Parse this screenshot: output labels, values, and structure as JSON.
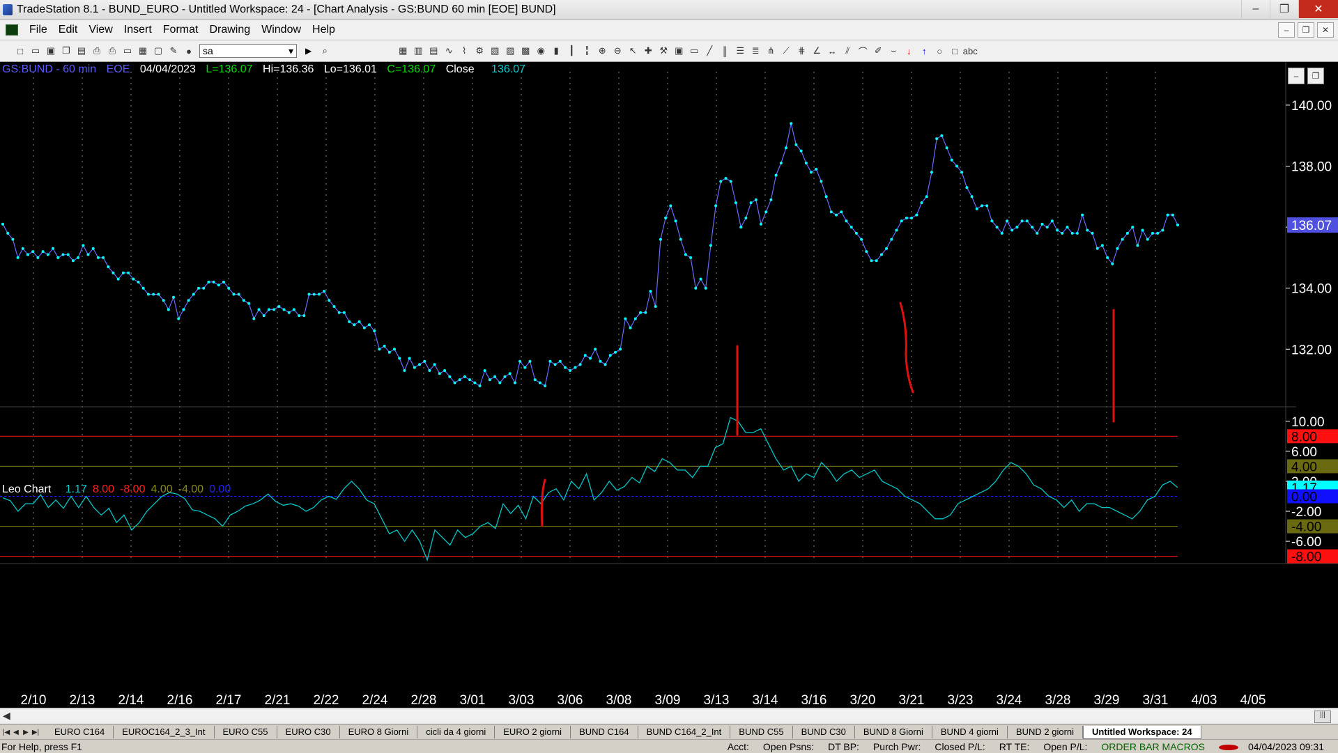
{
  "window": {
    "title": "TradeStation 8.1 - BUND_EURO - Untitled Workspace:  24 - [Chart Analysis - GS:BUND  60 min  [EOE] BUND]",
    "buttons": {
      "minimize": "–",
      "maximize": "❐",
      "close": "✕"
    }
  },
  "menu": {
    "items": [
      "File",
      "Edit",
      "View",
      "Insert",
      "Format",
      "Drawing",
      "Window",
      "Help"
    ],
    "mdi": {
      "minimize": "–",
      "restore": "❐",
      "close": "✕"
    }
  },
  "toolbar": {
    "symbol_value": "sa",
    "icons": [
      "new-icon",
      "open-icon",
      "save-icon",
      "copy-icon",
      "folder-icon",
      "print-icon",
      "print-preview-icon",
      "window-icon",
      "window-tile-icon",
      "lock-icon",
      "tools-icon",
      "globe-icon"
    ],
    "icons2": [
      "grid-icon",
      "layout-icon",
      "table-icon",
      "chart-style-icon",
      "indicator-icon",
      "strategy-icon",
      "format-icon",
      "window-arrange-icon",
      "data-icon",
      "radar-icon",
      "bar-chart-icon",
      "bars-icon",
      "candles-icon",
      "zoom-in-icon",
      "zoom-out-icon",
      "pointer-icon",
      "crosshair-icon",
      "hammer-icon",
      "snapshot-icon",
      "doc-icon",
      "trendline-icon",
      "vertical-lines-icon",
      "horizontal-lines-icon",
      "fibonacci-icon",
      "andrews-icon",
      "speed-icon",
      "gann-icon",
      "angle-icon",
      "arrow-lr-icon",
      "parallel-icon",
      "arc-icon",
      "pen-icon",
      "curve-icon",
      "arrow-down-icon",
      "arrow-up-icon",
      "circle-icon",
      "rectangle-icon",
      "text-icon"
    ]
  },
  "chart": {
    "header": {
      "symbol": "GS:BUND - 60 min",
      "session": "EOE",
      "date": "04/04/2023",
      "last": "L=136.07",
      "high": "Hi=136.36",
      "low": "Lo=136.01",
      "close": "C=136.07",
      "close_label": "Close",
      "close_value": "136.07"
    },
    "indicator_header": {
      "name": "Leo Chart",
      "values": [
        {
          "text": "1.17",
          "color": "#00d0d0"
        },
        {
          "text": "8.00",
          "color": "#ff2020"
        },
        {
          "text": "-8.00",
          "color": "#ff2020"
        },
        {
          "text": "4.00",
          "color": "#8a8a1a"
        },
        {
          "text": "-4.00",
          "color": "#8a8a1a"
        },
        {
          "text": "0.00",
          "color": "#2020ff"
        }
      ]
    },
    "price_axis_labels": [
      "140.00",
      "138.00",
      "136.00",
      "134.00",
      "132.00"
    ],
    "price_last_label": "136.07",
    "indicator_axis_labels": [
      "10.00",
      "6.00",
      "2.00",
      "-2.00",
      "-6.00"
    ],
    "indicator_badges": [
      {
        "text": "8.00",
        "value": 8,
        "bg": "#ff1010",
        "fg": "#000000"
      },
      {
        "text": "4.00",
        "value": 4,
        "bg": "#6a6a10",
        "fg": "#000000"
      },
      {
        "text": "1.17",
        "value": 1.17,
        "bg": "#00ffff",
        "fg": "#000000"
      },
      {
        "text": "0.00",
        "value": 0,
        "bg": "#1010ff",
        "fg": "#000000"
      },
      {
        "text": "-4.00",
        "value": -4,
        "bg": "#6a6a10",
        "fg": "#000000"
      },
      {
        "text": "-8.00",
        "value": -8,
        "bg": "#ff1010",
        "fg": "#000000"
      }
    ],
    "date_labels": [
      "2/10",
      "2/13",
      "2/14",
      "2/16",
      "2/17",
      "2/21",
      "2/22",
      "2/24",
      "2/28",
      "3/01",
      "3/03",
      "3/06",
      "3/08",
      "3/09",
      "3/13",
      "3/14",
      "3/16",
      "3/20",
      "3/21",
      "3/23",
      "3/24",
      "3/28",
      "3/29",
      "3/31",
      "4/03",
      "4/05"
    ],
    "colors": {
      "price_line": "#6a6aff",
      "price_dots": "#00ffff",
      "indicator_line": "#00c8c8",
      "red_line": "#e01010",
      "olive_line": "#6a6a10",
      "zero_line": "#2020ff",
      "grid": "#808080",
      "text_axis": "#ffffff"
    }
  },
  "chart_data": {
    "type": "line",
    "title": "GS:BUND - 60 min",
    "series": [
      {
        "name": "Close",
        "values": [
          136.1,
          135.8,
          135.6,
          135.0,
          135.3,
          135.1,
          135.2,
          135.0,
          135.2,
          135.1,
          135.3,
          135.0,
          135.1,
          135.1,
          134.9,
          135.0,
          135.4,
          135.1,
          135.3,
          135.0,
          135.0,
          134.7,
          134.5,
          134.3,
          134.5,
          134.5,
          134.3,
          134.2,
          134.0,
          133.8,
          133.8,
          133.8,
          133.6,
          133.3,
          133.7,
          133.0,
          133.3,
          133.6,
          133.8,
          134.0,
          134.0,
          134.2,
          134.2,
          134.1,
          134.2,
          134.0,
          133.8,
          133.8,
          133.6,
          133.5,
          133.0,
          133.3,
          133.1,
          133.3,
          133.3,
          133.4,
          133.3,
          133.2,
          133.3,
          133.1,
          133.1,
          133.8,
          133.8,
          133.8,
          133.9,
          133.6,
          133.4,
          133.2,
          133.2,
          132.9,
          132.8,
          132.9,
          132.7,
          132.8,
          132.6,
          132.0,
          132.1,
          131.9,
          132.0,
          131.7,
          131.3,
          131.7,
          131.4,
          131.5,
          131.6,
          131.3,
          131.5,
          131.2,
          131.3,
          131.1,
          130.9,
          131.0,
          131.1,
          131.0,
          130.9,
          130.8,
          131.3,
          131.0,
          131.1,
          130.9,
          131.1,
          131.2,
          130.9,
          131.6,
          131.4,
          131.6,
          131.0,
          130.9,
          130.8,
          131.6,
          131.5,
          131.6,
          131.4,
          131.3,
          131.4,
          131.5,
          131.8,
          131.7,
          132.0,
          131.6,
          131.5,
          131.8,
          131.9,
          132.0,
          133.0,
          132.7,
          133.0,
          133.2,
          133.2,
          133.9,
          133.4,
          135.6,
          136.3,
          136.7,
          136.2,
          135.6,
          135.1,
          135.0,
          134.0,
          134.3,
          134.0,
          135.4,
          136.7,
          137.5,
          137.6,
          137.5,
          136.8,
          136.0,
          136.3,
          136.8,
          136.9,
          136.1,
          136.5,
          136.9,
          137.7,
          138.1,
          138.6,
          139.4,
          138.7,
          138.5,
          138.1,
          137.8,
          137.9,
          137.5,
          137.0,
          136.5,
          136.4,
          136.5,
          136.2,
          136.0,
          135.8,
          135.6,
          135.2,
          134.9,
          134.9,
          135.1,
          135.3,
          135.6,
          135.9,
          136.2,
          136.3,
          136.3,
          136.4,
          136.8,
          137.0,
          137.8,
          138.9,
          139.0,
          138.6,
          138.2,
          138.0,
          137.8,
          137.3,
          137.0,
          136.6,
          136.7,
          136.7,
          136.2,
          136.0,
          135.8,
          136.2,
          135.9,
          136.0,
          136.2,
          136.2,
          136.0,
          135.8,
          136.1,
          136.0,
          136.2,
          135.9,
          135.8,
          136.0,
          135.8,
          135.8,
          136.4,
          135.9,
          135.8,
          135.3,
          135.4,
          135.0,
          134.8,
          135.3,
          135.6,
          135.8,
          136.0,
          135.4,
          135.9,
          135.6,
          135.8,
          135.8,
          135.9,
          136.4,
          136.4,
          136.07
        ]
      },
      {
        "name": "Leo Chart",
        "values": [
          -0.2,
          -0.6,
          -2.0,
          -1.0,
          -1.0,
          0.2,
          -1.5,
          -0.5,
          -1.6,
          0.0,
          -1.5,
          0.0,
          -1.5,
          -2.5,
          -1.6,
          -3.5,
          -2.5,
          -4.5,
          -3.5,
          -2.0,
          -1.0,
          0.0,
          0.5,
          0.3,
          -0.3,
          -1.8,
          -2.0,
          -2.5,
          -3.0,
          -4.0,
          -2.5,
          -2.0,
          -1.3,
          -1.0,
          -0.5,
          0.3,
          -0.7,
          -1.2,
          -1.0,
          -1.3,
          -2.0,
          -1.5,
          -0.5,
          0.0,
          -0.4,
          1.0,
          2.0,
          1.0,
          -0.5,
          -1.0,
          -3.0,
          -5.0,
          -4.5,
          -6.0,
          -4.5,
          -6.0,
          -8.5,
          -4.5,
          -5.5,
          -6.5,
          -4.5,
          -5.5,
          -5.0,
          -4.0,
          -3.5,
          -4.3,
          -1.0,
          -2.3,
          -1.2,
          -3.0,
          0.0,
          -1.0,
          0.5,
          1.0,
          -0.5,
          2.0,
          1.0,
          3.0,
          -0.5,
          0.5,
          2.0,
          0.8,
          1.3,
          2.5,
          1.8,
          4.0,
          3.3,
          5.0,
          4.5,
          3.5,
          3.5,
          2.5,
          4.0,
          4.0,
          6.5,
          7.0,
          10.5,
          10.0,
          8.5,
          8.5,
          9.0,
          7.0,
          5.0,
          3.5,
          4.0,
          2.0,
          3.0,
          2.5,
          4.5,
          3.5,
          2.0,
          3.0,
          3.5,
          2.5,
          3.0,
          3.5,
          2.0,
          1.5,
          1.0,
          0.0,
          -0.5,
          -1.0,
          -2.0,
          -3.0,
          -3.0,
          -2.5,
          -1.0,
          -0.5,
          0.0,
          0.5,
          1.0,
          2.0,
          3.5,
          4.5,
          4.0,
          3.0,
          1.5,
          1.0,
          0.0,
          -0.5,
          -1.5,
          -0.5,
          -2.0,
          -1.0,
          -1.0,
          -1.5,
          -1.5,
          -2.0,
          -2.5,
          -3.0,
          -2.0,
          -0.5,
          0.0,
          1.5,
          2.0,
          1.17
        ]
      }
    ],
    "x": [
      "2/10",
      "2/13",
      "2/14",
      "2/16",
      "2/17",
      "2/21",
      "2/22",
      "2/24",
      "2/28",
      "3/01",
      "3/03",
      "3/06",
      "3/08",
      "3/09",
      "3/13",
      "3/14",
      "3/16",
      "3/20",
      "3/21",
      "3/23",
      "3/24",
      "3/28",
      "3/29",
      "3/31",
      "4/03",
      "4/05"
    ],
    "ylim": [
      130.5,
      140.5
    ],
    "indicator_ylim": [
      -8.5,
      11
    ],
    "indicator_levels": [
      8,
      4,
      0,
      -4,
      -8
    ],
    "grid": true
  },
  "tabs": {
    "items": [
      "EURO C164",
      "EUROC164_2_3_Int",
      "EURO C55",
      "EURO C30",
      "EURO 8 Giorni",
      "cicli da 4 giorni",
      "EURO 2 giorni",
      "BUND C164",
      "BUND C164_2_Int",
      "BUND C55",
      "BUND  C30",
      "BUND 8 Giorni",
      "BUND 4 giorni",
      "BUND 2 giorni",
      "Untitled Workspace:  24"
    ],
    "active_index": 14
  },
  "status": {
    "help": "For Help, press F1",
    "fields": [
      "Acct:",
      "Open Psns:",
      "DT BP:",
      "Purch Pwr:",
      "Closed P/L:",
      "RT TE:",
      "Open P/L:"
    ],
    "macros": "ORDER BAR  MACROS",
    "datetime": "04/04/2023 09:31"
  }
}
